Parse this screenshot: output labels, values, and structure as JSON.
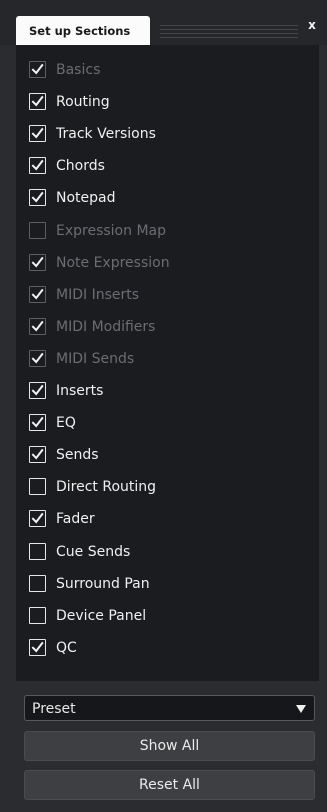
{
  "panel": {
    "tab_title": "Set up Sections",
    "close_label": "x"
  },
  "sections": [
    {
      "label": "Basics",
      "checked": true,
      "enabled": false
    },
    {
      "label": "Routing",
      "checked": true,
      "enabled": true
    },
    {
      "label": "Track Versions",
      "checked": true,
      "enabled": true
    },
    {
      "label": "Chords",
      "checked": true,
      "enabled": true
    },
    {
      "label": "Notepad",
      "checked": true,
      "enabled": true
    },
    {
      "label": "Expression Map",
      "checked": false,
      "enabled": false
    },
    {
      "label": "Note Expression",
      "checked": true,
      "enabled": false
    },
    {
      "label": "MIDI Inserts",
      "checked": true,
      "enabled": false
    },
    {
      "label": "MIDI Modifiers",
      "checked": true,
      "enabled": false
    },
    {
      "label": "MIDI Sends",
      "checked": true,
      "enabled": false
    },
    {
      "label": "Inserts",
      "checked": true,
      "enabled": true
    },
    {
      "label": "EQ",
      "checked": true,
      "enabled": true
    },
    {
      "label": "Sends",
      "checked": true,
      "enabled": true
    },
    {
      "label": "Direct Routing",
      "checked": false,
      "enabled": true
    },
    {
      "label": "Fader",
      "checked": true,
      "enabled": true
    },
    {
      "label": "Cue Sends",
      "checked": false,
      "enabled": true
    },
    {
      "label": "Surround Pan",
      "checked": false,
      "enabled": true
    },
    {
      "label": "Device Panel",
      "checked": false,
      "enabled": true
    },
    {
      "label": "QC",
      "checked": true,
      "enabled": true
    }
  ],
  "preset": {
    "value": "Preset"
  },
  "buttons": {
    "show_all": "Show All",
    "reset_all": "Reset All"
  }
}
